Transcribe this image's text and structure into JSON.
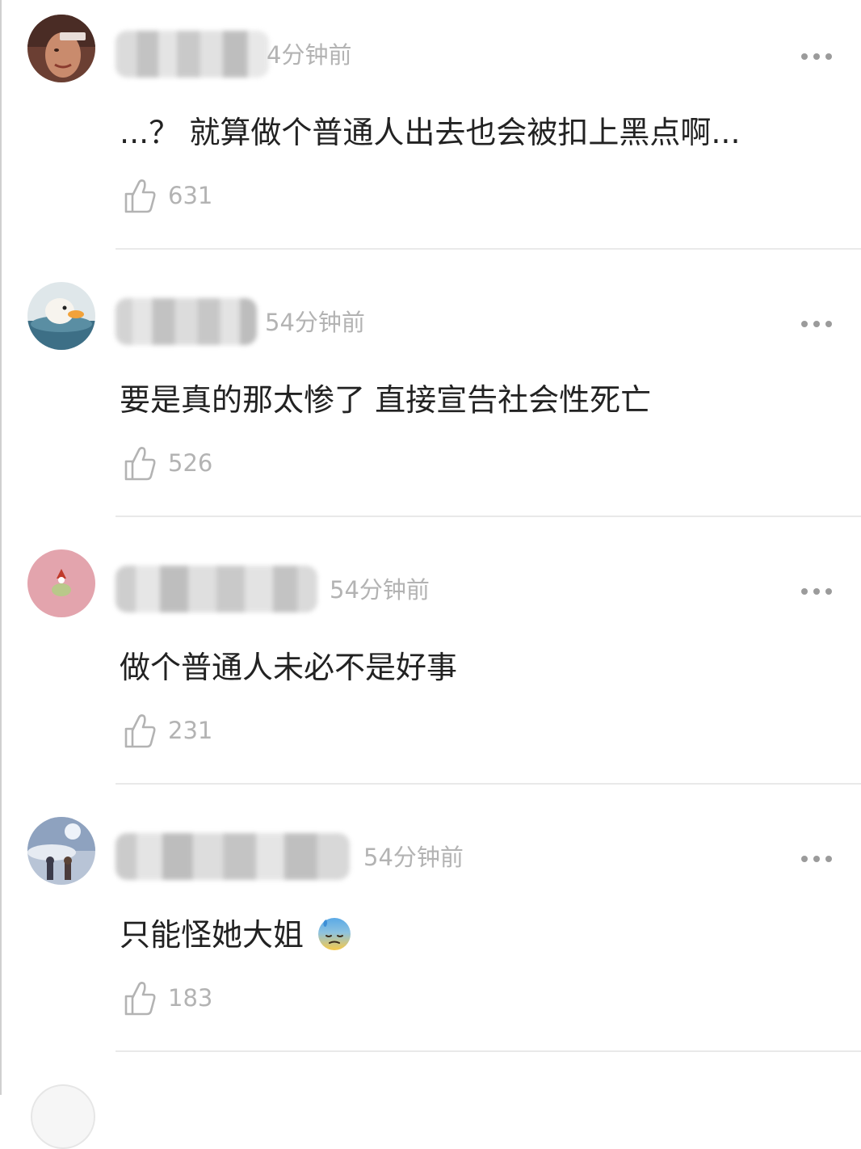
{
  "comments": [
    {
      "time": "4分钟前",
      "text": "...？ 就算做个普通人出去也会被扣上黑点啊...",
      "likes": "631",
      "avatar_icon": "person-photo-avatar"
    },
    {
      "time": "54分钟前",
      "text": "要是真的那太惨了 直接宣告社会性死亡",
      "likes": "526",
      "avatar_icon": "duck-avatar"
    },
    {
      "time": "54分钟前",
      "text": "做个普通人未必不是好事",
      "likes": "231",
      "avatar_icon": "pink-cartoon-avatar"
    },
    {
      "time": "54分钟前",
      "text": "只能怪她大姐",
      "likes": "183",
      "avatar_icon": "anime-sky-avatar",
      "emoji": "downcast-face-with-sweat-emoji"
    }
  ],
  "colors": {
    "text": "#222222",
    "secondary": "#b3b3b3",
    "divider": "#e9e9e9",
    "more_dots": "#9b9b9b"
  }
}
